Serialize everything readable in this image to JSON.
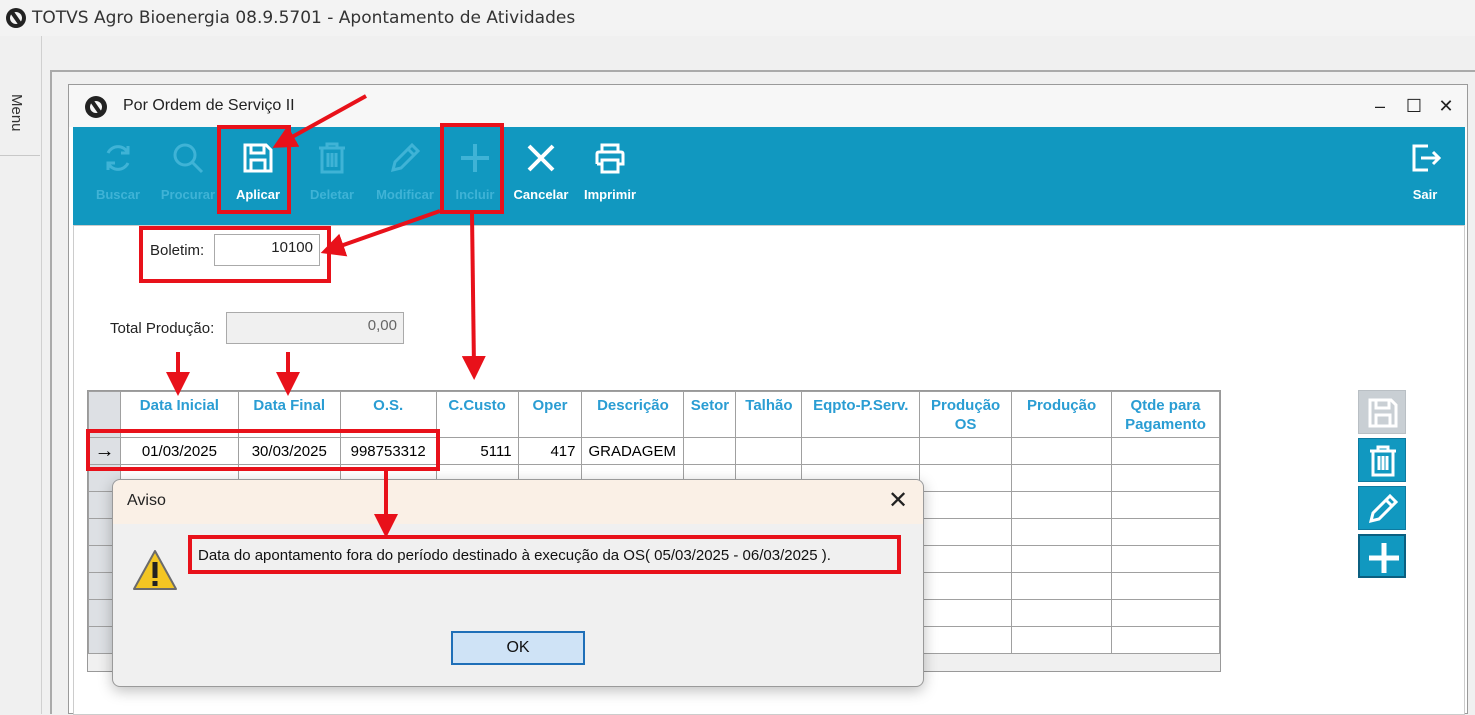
{
  "app": {
    "title": "TOTVS Agro Bioenergia 08.9.5701 - Apontamento de Atividades"
  },
  "sidebar": {
    "menu_label": "Menu"
  },
  "window": {
    "title": "Por Ordem de Serviço II",
    "minimize": "–",
    "maximize": "☐",
    "close": "✕"
  },
  "toolbar": {
    "buscar": "Buscar",
    "procurar": "Procurar",
    "aplicar": "Aplicar",
    "deletar": "Deletar",
    "modificar": "Modificar",
    "incluir": "Incluir",
    "cancelar": "Cancelar",
    "imprimir": "Imprimir",
    "sair": "Sair"
  },
  "form": {
    "boletim_label": "Boletim:",
    "boletim_value": "10100",
    "total_producao_label": "Total Produção:",
    "total_producao_value": "0,00"
  },
  "grid": {
    "columns": [
      "Data Inicial",
      "Data Final",
      "O.S.",
      "C.Custo",
      "Oper",
      "Descrição",
      "Setor",
      "Talhão",
      "Eqpto-P.Serv.",
      "Produção OS",
      "Produção",
      "Qtde para Pagamento"
    ],
    "row_indicator": "→",
    "rows": [
      {
        "data_inicial": "01/03/2025",
        "data_final": "30/03/2025",
        "os": "998753312",
        "c_custo": "5111",
        "oper": "417",
        "descricao": "GRADAGEM",
        "setor": "",
        "talhao": "",
        "eqpto": "",
        "producao_os": "",
        "producao": "",
        "qtde_pagamento": ""
      }
    ]
  },
  "dialog": {
    "title": "Aviso",
    "close": "✕",
    "message": "Data do apontamento fora do período destinado à execução da OS( 05/03/2025 - 06/03/2025 ).",
    "ok_label": "OK"
  },
  "colors": {
    "toolbar_bg": "#1198c0",
    "header_text": "#2a9dd3",
    "annotation_red": "#e8111a"
  }
}
